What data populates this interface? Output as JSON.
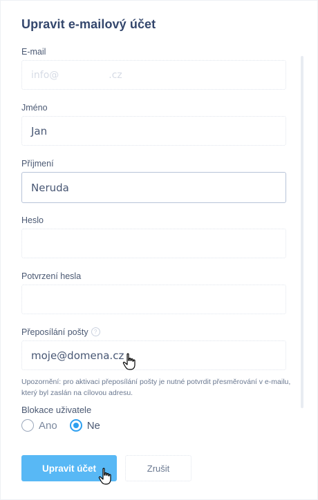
{
  "dialog": {
    "title": "Upravit e-mailový účet"
  },
  "fields": {
    "email": {
      "label": "E-mail",
      "value_prefix": "info@",
      "value_suffix": ".cz"
    },
    "first_name": {
      "label": "Jméno",
      "value": "Jan"
    },
    "last_name": {
      "label": "Příjmení",
      "value": "Neruda"
    },
    "password": {
      "label": "Heslo",
      "value": ""
    },
    "password_confirm": {
      "label": "Potvrzení hesla",
      "value": ""
    },
    "forwarding": {
      "label": "Přeposílání pošty",
      "help_icon_glyph": "?",
      "value": "moje@domena.cz",
      "note": "Upozornění: pro aktivaci přeposílání pošty je nutné potvrdit přesměrování v e-mailu, který byl zaslán na cílovou adresu."
    }
  },
  "user_block": {
    "label": "Blokace uživatele",
    "options": [
      {
        "label": "Ano",
        "checked": false
      },
      {
        "label": "Ne",
        "checked": true
      }
    ]
  },
  "actions": {
    "submit_label": "Upravit účet",
    "cancel_label": "Zrušit"
  },
  "colors": {
    "primary": "#58b8f5",
    "radio_checked": "#2d9ff0",
    "title": "#34476d"
  },
  "icons": {
    "cursor": "hand-pointer-icon",
    "help": "question-circle-icon"
  }
}
